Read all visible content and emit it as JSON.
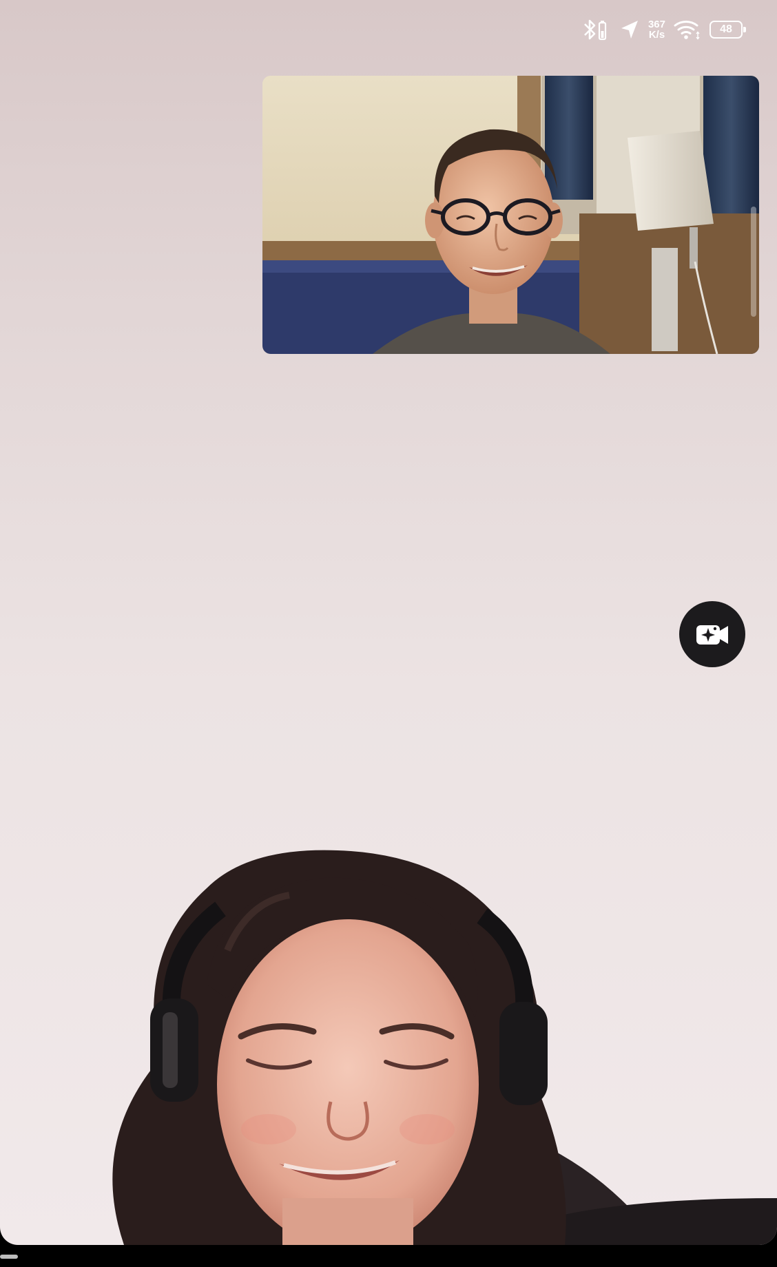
{
  "status_bar": {
    "bluetooth_icon": "bluetooth-battery-icon",
    "location_icon": "location-arrow-icon",
    "net_speed_value": "367",
    "net_speed_unit": "K/s",
    "wifi_icon": "wifi-icon",
    "battery_level": "48"
  },
  "call": {
    "self_view": "self-camera-preview",
    "remote_view": "remote-participant-video",
    "effects_button_icon": "video-effects-sparkle-icon"
  },
  "colors": {
    "background_top": "#d8c8c8",
    "background_bottom": "#f1e9ea",
    "button_bg": "#1c1b1d",
    "icon_white": "#ffffff"
  }
}
